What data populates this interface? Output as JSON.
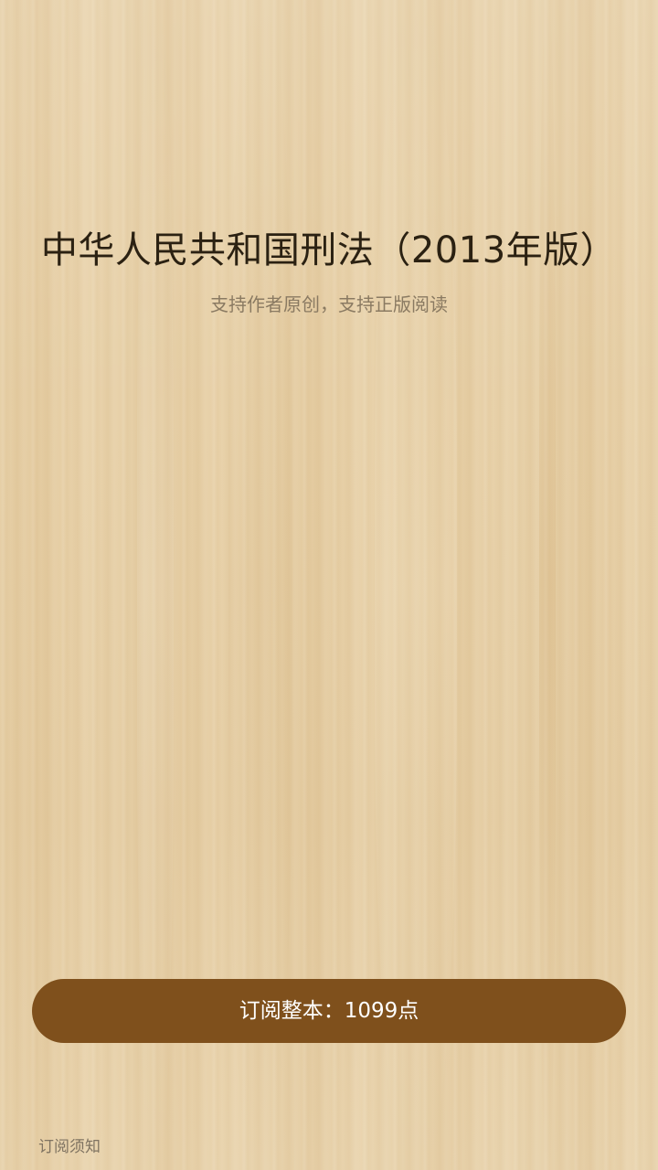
{
  "book": {
    "title": "中华人民共和国刑法（2013年版）",
    "subtitle": "支持作者原创，支持正版阅读"
  },
  "actions": {
    "subscribe_label": "订阅整本：1099点",
    "notice_label": "订阅须知"
  },
  "colors": {
    "background": "#e6cfa6",
    "button": "#7f501c",
    "title_text": "#2b2112",
    "subtitle_text": "#8a7a62"
  }
}
